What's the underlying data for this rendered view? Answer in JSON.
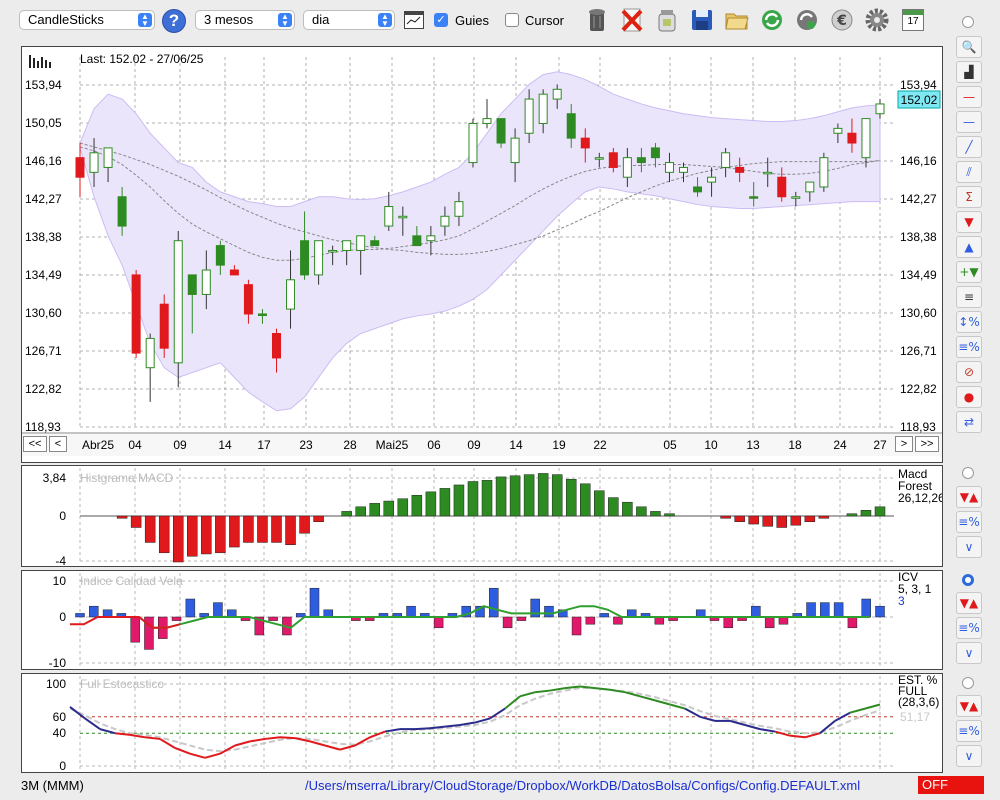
{
  "toolbar": {
    "chart_type": "CandleSticks",
    "period": "3 mesos",
    "interval": "dia",
    "guides_label": "Guies",
    "guides_checked": true,
    "cursor_label": "Cursor",
    "cursor_checked": false,
    "calendar_day": "17",
    "icons": [
      "help-icon",
      "chart-window-icon",
      "trash-icon",
      "delete-icon",
      "jar-icon",
      "save-icon",
      "open-folder-icon",
      "refresh-icon",
      "sync-icon",
      "euro-icon",
      "gear-icon",
      "calendar-icon"
    ]
  },
  "side_tools": [
    "zoom-icon",
    "indicator-icon",
    "horizontal-red-line-icon",
    "horizontal-blue-line-icon",
    "trend-line-icon",
    "channel-icon",
    "fibonacci-icon",
    "arrow-down-red-icon",
    "arrow-up-blue-icon",
    "add-arrows-icon",
    "lines-icon",
    "range-percent-icon",
    "level-percent-icon",
    "stop-icon",
    "record-icon",
    "swap-icon"
  ],
  "sub_tools": [
    "arrows-up-down-icon",
    "level-percent-icon",
    "curve-icon"
  ],
  "main_chart": {
    "info": "Last: 152.02 - 27/06/25",
    "y_ticks": [
      "153,94",
      "150,05",
      "146,16",
      "142,27",
      "138,38",
      "134,49",
      "130,60",
      "126,71",
      "122,82",
      "118,93"
    ],
    "last_value": "152,02",
    "x_labels": [
      "Abr25",
      "04",
      "09",
      "14",
      "17",
      "23",
      "28",
      "Mai25",
      "06",
      "09",
      "14",
      "19",
      "22",
      "05",
      "10",
      "13",
      "18",
      "24",
      "27"
    ],
    "nav": {
      "first": "<<",
      "prev": "<",
      "next": ">",
      "last": ">>"
    },
    "colors": {
      "up": "#2e8b22",
      "down": "#e0191c",
      "band": "#e8e2fb",
      "last_box": "#7fe8f2"
    }
  },
  "macd": {
    "title": "Histgrama MACD",
    "y_ticks": [
      "3,84",
      "0",
      "-4"
    ],
    "legend_line1": "Macd",
    "legend_line2": "Forest",
    "legend_line3": "26,12,26"
  },
  "icv": {
    "title": "Indice Calidad Vela",
    "y_ticks": [
      "10",
      "0",
      "-10"
    ],
    "legend_line1": "ICV",
    "legend_line2": "5, 3, 1",
    "legend_line3": "3"
  },
  "stoch": {
    "title": "Full Estocastico",
    "y_ticks": [
      "100",
      "60",
      "40",
      "0"
    ],
    "legend_line1": "EST. %",
    "legend_line2": "FULL",
    "legend_line3": "(28,3,6)",
    "legend_line4": "51,17"
  },
  "status": {
    "symbol": "3M (MMM)",
    "config_path": "/Users/mserra/Library/CloudStorage/Dropbox/WorkDB/DatosBolsa/Configs/Config.DEFAULT.xml",
    "toggle": "OFF"
  },
  "chart_data": {
    "type": "candlestick",
    "y_range": [
      118.93,
      153.94
    ],
    "candles": [
      {
        "o": 146.5,
        "h": 148,
        "l": 142.5,
        "c": 144.5
      },
      {
        "o": 145,
        "h": 148.5,
        "l": 143.5,
        "c": 147
      },
      {
        "o": 145.5,
        "h": 147.5,
        "l": 144,
        "c": 147.5
      },
      {
        "o": 142.5,
        "h": 143.5,
        "l": 138.5,
        "c": 139.5
      },
      {
        "o": 134.5,
        "h": 135,
        "l": 126,
        "c": 126.5
      },
      {
        "o": 125,
        "h": 128.5,
        "l": 121.5,
        "c": 128
      },
      {
        "o": 131.5,
        "h": 132.5,
        "l": 126,
        "c": 127
      },
      {
        "o": 125.5,
        "h": 139,
        "l": 123,
        "c": 138
      },
      {
        "o": 132.5,
        "h": 133.5,
        "l": 128.5,
        "c": 134.5
      },
      {
        "o": 132.5,
        "h": 137,
        "l": 131,
        "c": 135
      },
      {
        "o": 137.5,
        "h": 138,
        "l": 134.5,
        "c": 135.5
      },
      {
        "o": 135,
        "h": 135.5,
        "l": 134.5,
        "c": 134.5
      },
      {
        "o": 133.5,
        "h": 134,
        "l": 129.5,
        "c": 130.5
      },
      {
        "o": 130.5,
        "h": 131,
        "l": 129.5,
        "c": 130.5
      },
      {
        "o": 128.5,
        "h": 129,
        "l": 124.5,
        "c": 126
      },
      {
        "o": 131,
        "h": 137,
        "l": 129,
        "c": 134
      },
      {
        "o": 134.5,
        "h": 141,
        "l": 134,
        "c": 138
      },
      {
        "o": 134.5,
        "h": 137.5,
        "l": 133.5,
        "c": 138
      },
      {
        "o": 137,
        "h": 137.5,
        "l": 135.5,
        "c": 137
      },
      {
        "o": 137,
        "h": 138,
        "l": 135.5,
        "c": 138
      },
      {
        "o": 137,
        "h": 138.5,
        "l": 134.5,
        "c": 138.5
      },
      {
        "o": 138,
        "h": 138.5,
        "l": 137.5,
        "c": 137.5
      },
      {
        "o": 139.5,
        "h": 143,
        "l": 139,
        "c": 141.5
      },
      {
        "o": 140.5,
        "h": 141.5,
        "l": 138.5,
        "c": 140.5
      },
      {
        "o": 138.5,
        "h": 139.5,
        "l": 137.5,
        "c": 137.5
      },
      {
        "o": 138,
        "h": 139.5,
        "l": 136.5,
        "c": 138.5
      },
      {
        "o": 139.5,
        "h": 141.5,
        "l": 138.5,
        "c": 140.5
      },
      {
        "o": 140.5,
        "h": 143,
        "l": 139.5,
        "c": 142
      },
      {
        "o": 146,
        "h": 150.5,
        "l": 145.5,
        "c": 150
      },
      {
        "o": 150,
        "h": 152.5,
        "l": 149.5,
        "c": 150.5
      },
      {
        "o": 150.5,
        "h": 150.5,
        "l": 147.5,
        "c": 148
      },
      {
        "o": 146,
        "h": 149.5,
        "l": 144,
        "c": 148.5
      },
      {
        "o": 149,
        "h": 153.5,
        "l": 148,
        "c": 152.5
      },
      {
        "o": 150,
        "h": 153.5,
        "l": 149,
        "c": 153
      },
      {
        "o": 152.5,
        "h": 154,
        "l": 151.5,
        "c": 153.5
      },
      {
        "o": 151,
        "h": 152,
        "l": 147.5,
        "c": 148.5
      },
      {
        "o": 148.5,
        "h": 149.5,
        "l": 146,
        "c": 147.5
      },
      {
        "o": 146.5,
        "h": 147,
        "l": 145.5,
        "c": 146.5
      },
      {
        "o": 147,
        "h": 147.5,
        "l": 145,
        "c": 145.5
      },
      {
        "o": 144.5,
        "h": 147.5,
        "l": 143.5,
        "c": 146.5
      },
      {
        "o": 146,
        "h": 147.5,
        "l": 145,
        "c": 146.5
      },
      {
        "o": 147.5,
        "h": 148,
        "l": 145.5,
        "c": 146.5
      },
      {
        "o": 145,
        "h": 147,
        "l": 144,
        "c": 146
      },
      {
        "o": 145,
        "h": 146,
        "l": 144,
        "c": 145.5
      },
      {
        "o": 143.5,
        "h": 144.5,
        "l": 142.5,
        "c": 143
      },
      {
        "o": 144,
        "h": 145.5,
        "l": 142.5,
        "c": 144.5
      },
      {
        "o": 145.5,
        "h": 147.5,
        "l": 144.5,
        "c": 147
      },
      {
        "o": 145.5,
        "h": 146.5,
        "l": 144,
        "c": 145
      },
      {
        "o": 142.5,
        "h": 144,
        "l": 141.5,
        "c": 142.5
      },
      {
        "o": 145,
        "h": 146.5,
        "l": 143.5,
        "c": 145
      },
      {
        "o": 144.5,
        "h": 145.5,
        "l": 142,
        "c": 142.5
      },
      {
        "o": 142.5,
        "h": 143,
        "l": 141.5,
        "c": 142.5
      },
      {
        "o": 143,
        "h": 144,
        "l": 142,
        "c": 144
      },
      {
        "o": 143.5,
        "h": 147,
        "l": 143,
        "c": 146.5
      },
      {
        "o": 149,
        "h": 150,
        "l": 148,
        "c": 149.5
      },
      {
        "o": 149,
        "h": 150.5,
        "l": 147,
        "c": 148
      },
      {
        "o": 146.5,
        "h": 150.5,
        "l": 145.5,
        "c": 150.5
      },
      {
        "o": 151,
        "h": 152.5,
        "l": 150.5,
        "c": 152
      }
    ],
    "ma_long": [
      148,
      147.6,
      147.2,
      146.8,
      146.3,
      145.8,
      145.2,
      144.6,
      143.9,
      143.2,
      142.4,
      141.7,
      141,
      140.4,
      139.8,
      139.3,
      138.9,
      138.5,
      138.1,
      137.8,
      137.5,
      137.3,
      137.1,
      137,
      136.8,
      136.7,
      136.6,
      136.6,
      136.7,
      136.9,
      137.2,
      137.6,
      138,
      138.5,
      139.1,
      139.7,
      140.4,
      141,
      141.7,
      142.4,
      143,
      143.6,
      144.1,
      144.5,
      144.9,
      145.2,
      145.5,
      145.7,
      145.9,
      146,
      146.1,
      146.1,
      146.1,
      146.1,
      146.1,
      146.1,
      146.1,
      146.2
    ],
    "ma_short": [
      147.6,
      147.2,
      146.6,
      145.8,
      144.7,
      143.5,
      142.1,
      140.8,
      139.7,
      138.9,
      138.2,
      137.5,
      136.8,
      136.3,
      136,
      136,
      136.2,
      136.5,
      136.8,
      137,
      137.1,
      137.1,
      137.2,
      137.4,
      137.6,
      137.8,
      138.1,
      138.5,
      139.2,
      140,
      140.8,
      141.6,
      142.5,
      143.3,
      144,
      144.6,
      145.1,
      145.4,
      145.6,
      145.7,
      145.7,
      145.8,
      145.8,
      145.8,
      145.7,
      145.6,
      145.5,
      145.3,
      145.1,
      144.9,
      144.8,
      144.8,
      144.9,
      145.1,
      145.4,
      145.8,
      146,
      146.2
    ],
    "bb_upper": [
      148,
      151.5,
      153,
      152.5,
      151,
      149,
      147.5,
      146,
      145.5,
      144,
      143,
      142.5,
      142,
      141.8,
      141.5,
      141.5,
      142,
      142.5,
      142.5,
      142.3,
      142.2,
      142.3,
      142.6,
      143,
      143.5,
      144,
      144.8,
      145.5,
      147,
      149,
      151,
      152.5,
      154,
      155,
      155.3,
      155,
      154.5,
      153.8,
      153,
      152.5,
      152,
      151.6,
      151.3,
      151,
      150.8,
      150.6,
      150.5,
      150.4,
      150.3,
      150.2,
      150.2,
      150.3,
      150.5,
      150.8,
      151.2,
      151.6,
      151.8,
      151.9
    ],
    "bb_lower": [
      147.5,
      142.5,
      138.5,
      135.5,
      131.5,
      127.5,
      125,
      124,
      124.5,
      125,
      125.5,
      124,
      122.5,
      121.5,
      120.6,
      120.8,
      122,
      124,
      126,
      127.5,
      128.5,
      129,
      129.5,
      130,
      130.3,
      130.5,
      130.8,
      131.3,
      132,
      133,
      134.5,
      136,
      137.5,
      139,
      140.5,
      141.8,
      143,
      143.5,
      143.3,
      143,
      142.8,
      142.6,
      142.3,
      142,
      141.7,
      141.5,
      141.4,
      141.3,
      141.3,
      141.4,
      141.5,
      141.6,
      141.7,
      141.8,
      141.9,
      142,
      142,
      142
    ],
    "macd_hist": [
      0,
      0,
      0,
      -0.2,
      -1,
      -2.3,
      -3.2,
      -4,
      -3.5,
      -3.3,
      -3.2,
      -2.7,
      -2.3,
      -2.3,
      -2.3,
      -2.5,
      -1.5,
      -0.5,
      0,
      0.4,
      0.8,
      1.1,
      1.3,
      1.5,
      1.8,
      2.1,
      2.4,
      2.7,
      3,
      3.1,
      3.4,
      3.5,
      3.6,
      3.7,
      3.6,
      3.2,
      2.8,
      2.2,
      1.6,
      1.2,
      0.8,
      0.4,
      0.2,
      0,
      0,
      0,
      -0.2,
      -0.5,
      -0.7,
      -0.9,
      -1,
      -0.8,
      -0.5,
      -0.2,
      0,
      0.2,
      0.5,
      0.8
    ],
    "icv_bars": [
      1,
      3,
      2,
      1,
      -7,
      -9,
      -6,
      -1,
      5,
      1,
      4,
      2,
      -1,
      -5,
      -1,
      -5,
      1,
      8,
      2,
      0,
      -1,
      -1,
      1,
      1,
      3,
      1,
      -3,
      1,
      3,
      3,
      8,
      -3,
      -1,
      5,
      3,
      2,
      -5,
      -2,
      1,
      -2,
      2,
      1,
      -2,
      -1,
      0,
      2,
      -1,
      -3,
      -1,
      3,
      -3,
      -2,
      1,
      4,
      4,
      4,
      -3,
      5,
      3
    ],
    "icv_line": [
      -2,
      -2,
      0,
      0,
      0,
      0,
      -3,
      -3,
      -2,
      -1,
      0,
      0,
      0,
      0,
      -1,
      -2,
      -3,
      0,
      0,
      0,
      0,
      0,
      0,
      0,
      0,
      0,
      0,
      0,
      0,
      1,
      3,
      2,
      1,
      1,
      1,
      1,
      2,
      3,
      3,
      2,
      0,
      0,
      0,
      0,
      0,
      0,
      0,
      0,
      0,
      0,
      0,
      0,
      0,
      0,
      0,
      0,
      0,
      0,
      0
    ],
    "stoch_k": [
      72,
      58,
      45,
      40,
      38,
      35,
      33,
      22,
      15,
      10,
      15,
      25,
      30,
      33,
      35,
      34,
      30,
      25,
      20,
      25,
      35,
      42,
      45,
      45,
      46,
      48,
      50,
      53,
      58,
      70,
      85,
      90,
      92,
      95,
      97,
      95,
      93,
      90,
      85,
      80,
      75,
      70,
      60,
      55,
      55,
      50,
      45,
      42,
      37,
      35,
      40,
      55,
      65,
      70,
      75
    ],
    "stoch_d": [
      70,
      62,
      52,
      45,
      40,
      38,
      35,
      30,
      25,
      20,
      18,
      20,
      24,
      28,
      32,
      34,
      33,
      30,
      27,
      26,
      30,
      36,
      41,
      44,
      45,
      46,
      48,
      50,
      54,
      62,
      74,
      82,
      88,
      92,
      95,
      95,
      93,
      91,
      88,
      84,
      79,
      74,
      67,
      61,
      57,
      53,
      49,
      46,
      42,
      40,
      41,
      47,
      55,
      62,
      68
    ]
  }
}
